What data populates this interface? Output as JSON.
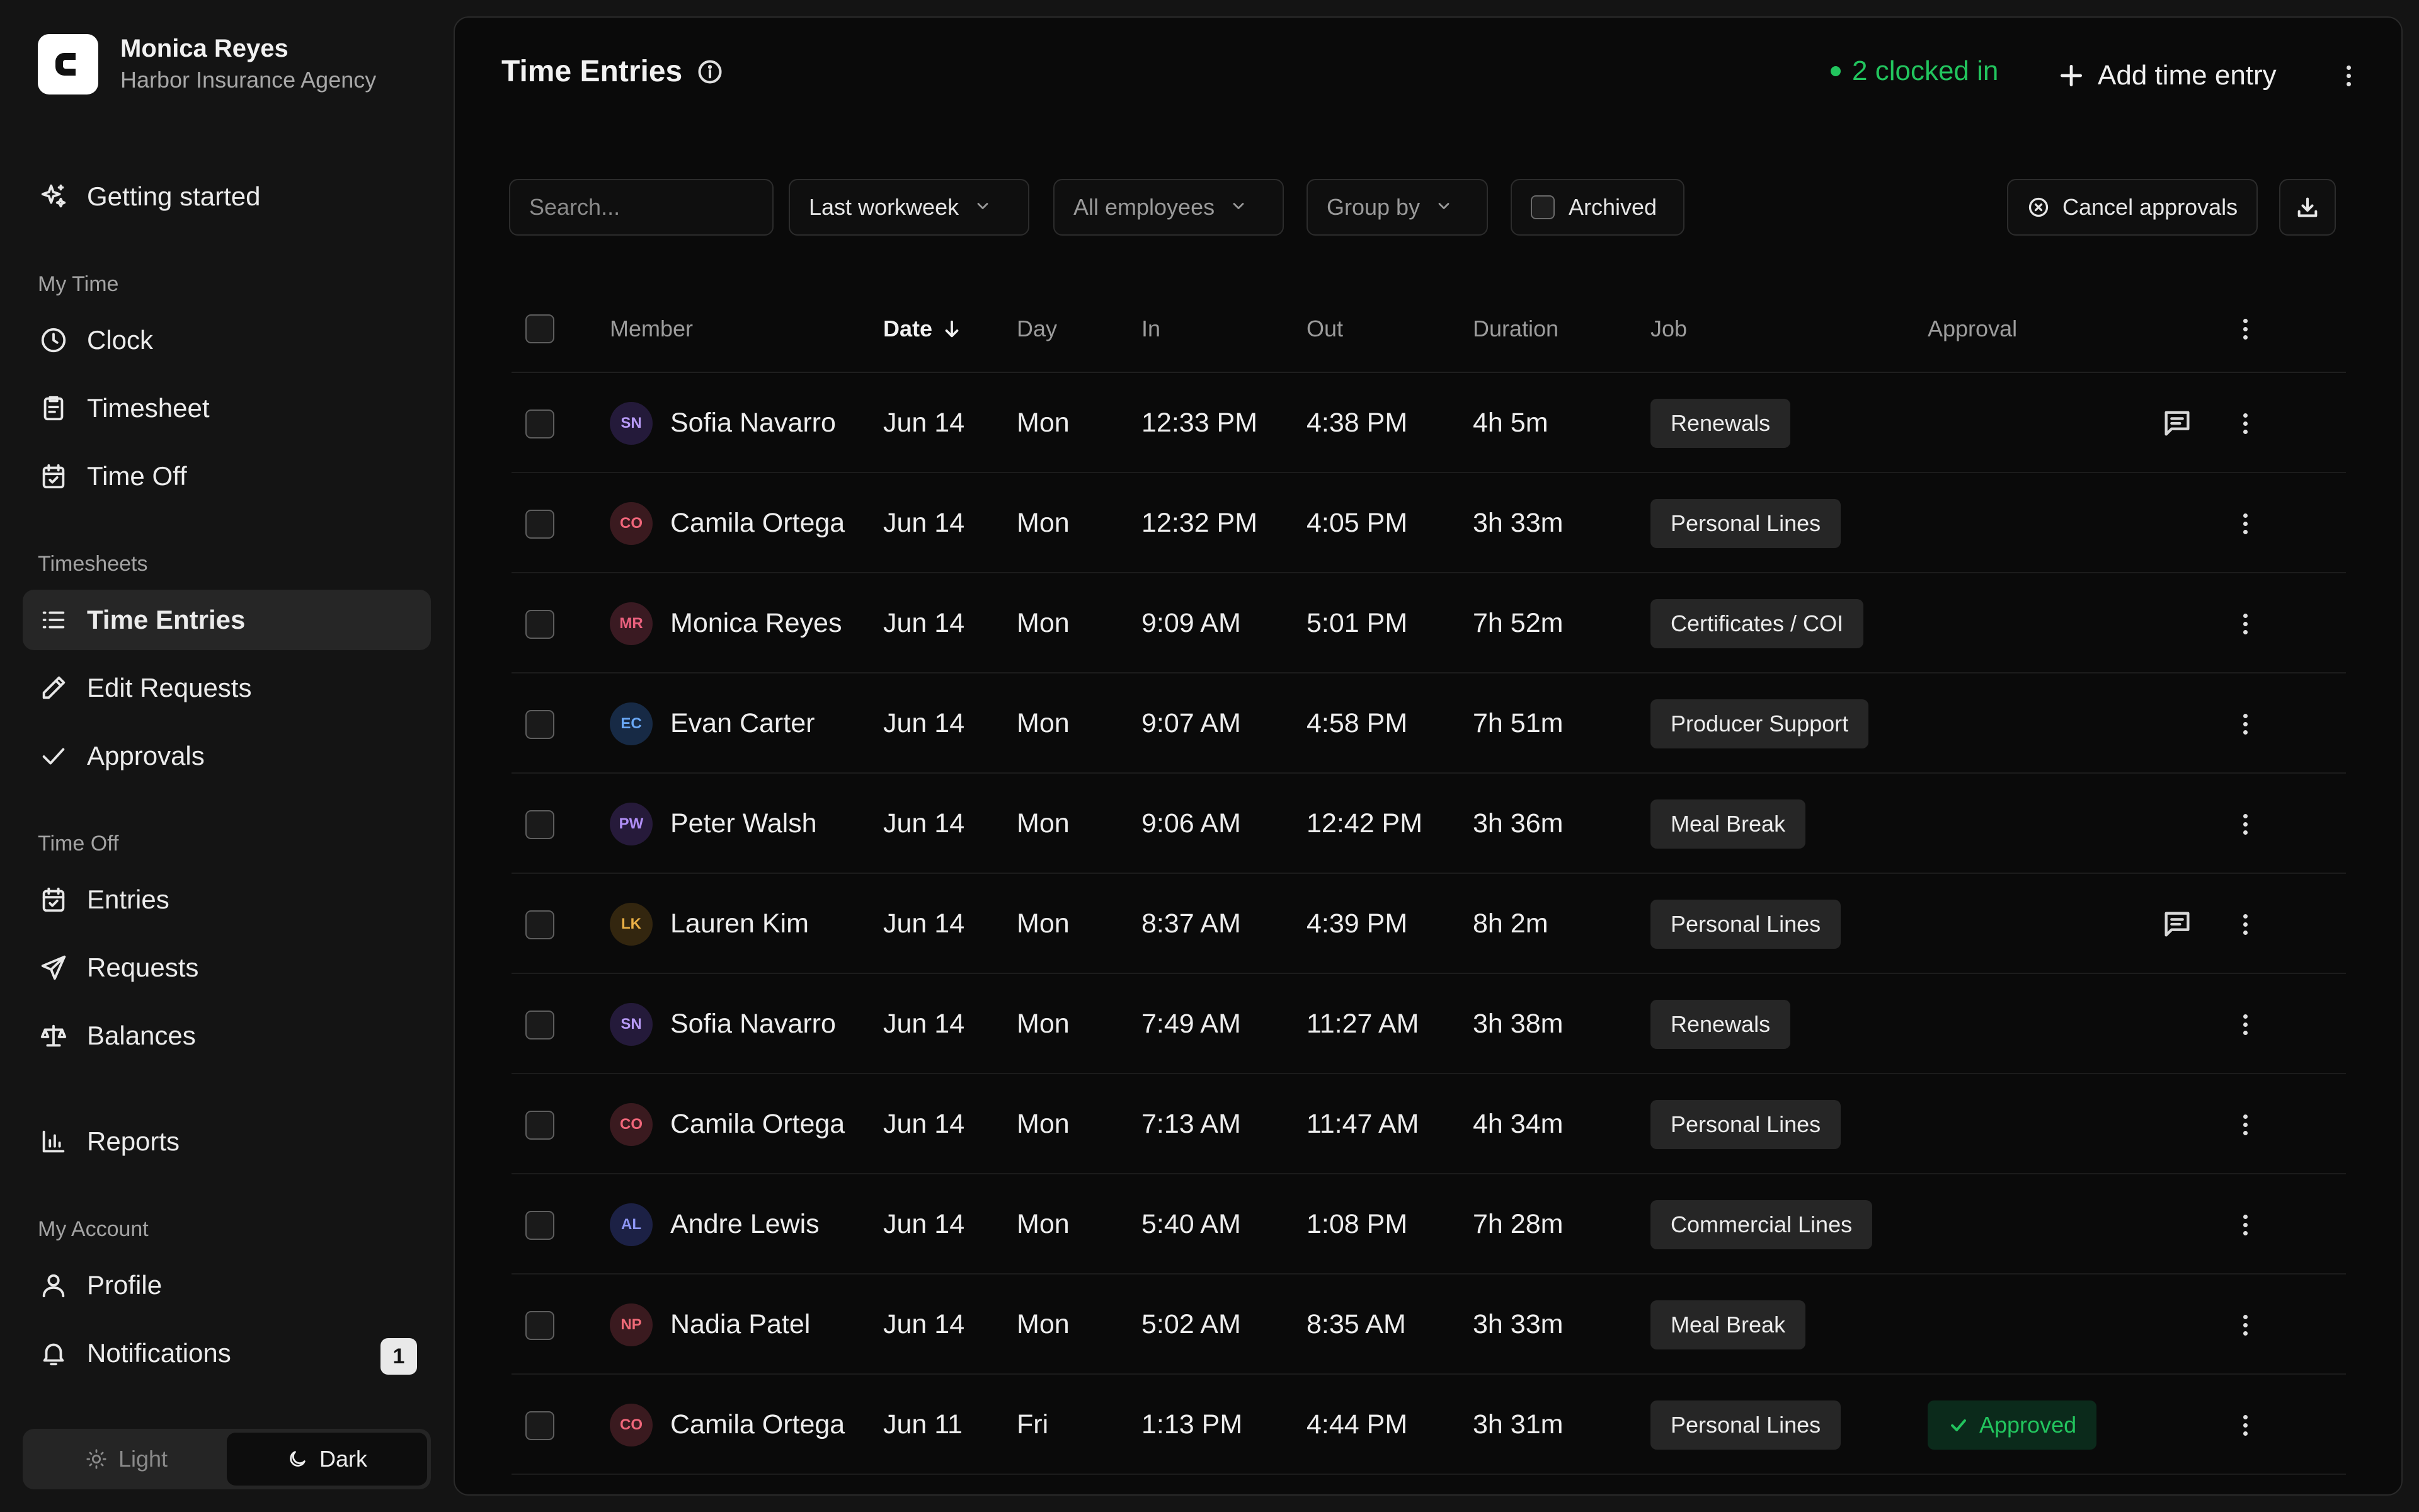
{
  "account": {
    "logo_letter": "C",
    "user_name": "Monica Reyes",
    "org_name": "Harbor Insurance Agency"
  },
  "nav": {
    "getting_started": "Getting started",
    "sections": {
      "my_time": "My Time",
      "timesheets": "Timesheets",
      "time_off": "Time Off",
      "my_account": "My Account"
    },
    "clock": "Clock",
    "timesheet": "Timesheet",
    "time_off_item": "Time Off",
    "time_entries": "Time Entries",
    "edit_requests": "Edit Requests",
    "approvals": "Approvals",
    "entries": "Entries",
    "requests": "Requests",
    "balances": "Balances",
    "reports": "Reports",
    "profile": "Profile",
    "notifications": "Notifications",
    "notifications_count": "1",
    "active": "Time Entries"
  },
  "theme": {
    "light": "Light",
    "dark": "Dark",
    "selected": "Dark"
  },
  "header": {
    "title": "Time Entries",
    "clocked_in": "2 clocked in",
    "add_entry": "Add time entry"
  },
  "toolbar": {
    "search_placeholder": "Search...",
    "date_range": "Last workweek",
    "employees": "All employees",
    "group_by": "Group by",
    "archived": "Archived",
    "cancel_approvals": "Cancel approvals"
  },
  "table": {
    "columns": {
      "member": "Member",
      "date": "Date",
      "day": "Day",
      "in": "In",
      "out": "Out",
      "duration": "Duration",
      "job": "Job",
      "approval": "Approval"
    },
    "rows": [
      {
        "initials": "SN",
        "member": "Sofia Navarro",
        "date": "Jun 14",
        "day": "Mon",
        "in": "12:33 PM",
        "out": "4:38 PM",
        "duration": "4h 5m",
        "job": "Renewals",
        "approval": "",
        "note": true
      },
      {
        "initials": "CO",
        "member": "Camila Ortega",
        "date": "Jun 14",
        "day": "Mon",
        "in": "12:32 PM",
        "out": "4:05 PM",
        "duration": "3h 33m",
        "job": "Personal Lines",
        "approval": "",
        "note": false
      },
      {
        "initials": "MR",
        "member": "Monica Reyes",
        "date": "Jun 14",
        "day": "Mon",
        "in": "9:09 AM",
        "out": "5:01 PM",
        "duration": "7h 52m",
        "job": "Certificates / COI",
        "approval": "",
        "note": false
      },
      {
        "initials": "EC",
        "member": "Evan Carter",
        "date": "Jun 14",
        "day": "Mon",
        "in": "9:07 AM",
        "out": "4:58 PM",
        "duration": "7h 51m",
        "job": "Producer Support",
        "approval": "",
        "note": false
      },
      {
        "initials": "PW",
        "member": "Peter Walsh",
        "date": "Jun 14",
        "day": "Mon",
        "in": "9:06 AM",
        "out": "12:42 PM",
        "duration": "3h 36m",
        "job": "Meal Break",
        "approval": "",
        "note": false
      },
      {
        "initials": "LK",
        "member": "Lauren Kim",
        "date": "Jun 14",
        "day": "Mon",
        "in": "8:37 AM",
        "out": "4:39 PM",
        "duration": "8h 2m",
        "job": "Personal Lines",
        "approval": "",
        "note": true
      },
      {
        "initials": "SN",
        "member": "Sofia Navarro",
        "date": "Jun 14",
        "day": "Mon",
        "in": "7:49 AM",
        "out": "11:27 AM",
        "duration": "3h 38m",
        "job": "Renewals",
        "approval": "",
        "note": false
      },
      {
        "initials": "CO",
        "member": "Camila Ortega",
        "date": "Jun 14",
        "day": "Mon",
        "in": "7:13 AM",
        "out": "11:47 AM",
        "duration": "4h 34m",
        "job": "Personal Lines",
        "approval": "",
        "note": false
      },
      {
        "initials": "AL",
        "member": "Andre Lewis",
        "date": "Jun 14",
        "day": "Mon",
        "in": "5:40 AM",
        "out": "1:08 PM",
        "duration": "7h 28m",
        "job": "Commercial Lines",
        "approval": "",
        "note": false
      },
      {
        "initials": "NP",
        "member": "Nadia Patel",
        "date": "Jun 14",
        "day": "Mon",
        "in": "5:02 AM",
        "out": "8:35 AM",
        "duration": "3h 33m",
        "job": "Meal Break",
        "approval": "",
        "note": false
      },
      {
        "initials": "CO",
        "member": "Camila Ortega",
        "date": "Jun 11",
        "day": "Fri",
        "in": "1:13 PM",
        "out": "4:44 PM",
        "duration": "3h 31m",
        "job": "Personal Lines",
        "approval": "Approved",
        "note": false
      }
    ]
  },
  "colors": {
    "accent_green": "#22c55e",
    "avatar": {
      "SN": [
        "#241a3a",
        "#b79af5"
      ],
      "CO": [
        "#3a1a1f",
        "#f0667a"
      ],
      "MR": [
        "#3a1a22",
        "#e9607d"
      ],
      "EC": [
        "#172a45",
        "#6aa8f5"
      ],
      "PW": [
        "#261a3a",
        "#b08ef5"
      ],
      "LK": [
        "#33260f",
        "#eab046"
      ],
      "AL": [
        "#1c2145",
        "#8d96f5"
      ],
      "NP": [
        "#3a1a1f",
        "#f06a78"
      ]
    }
  }
}
